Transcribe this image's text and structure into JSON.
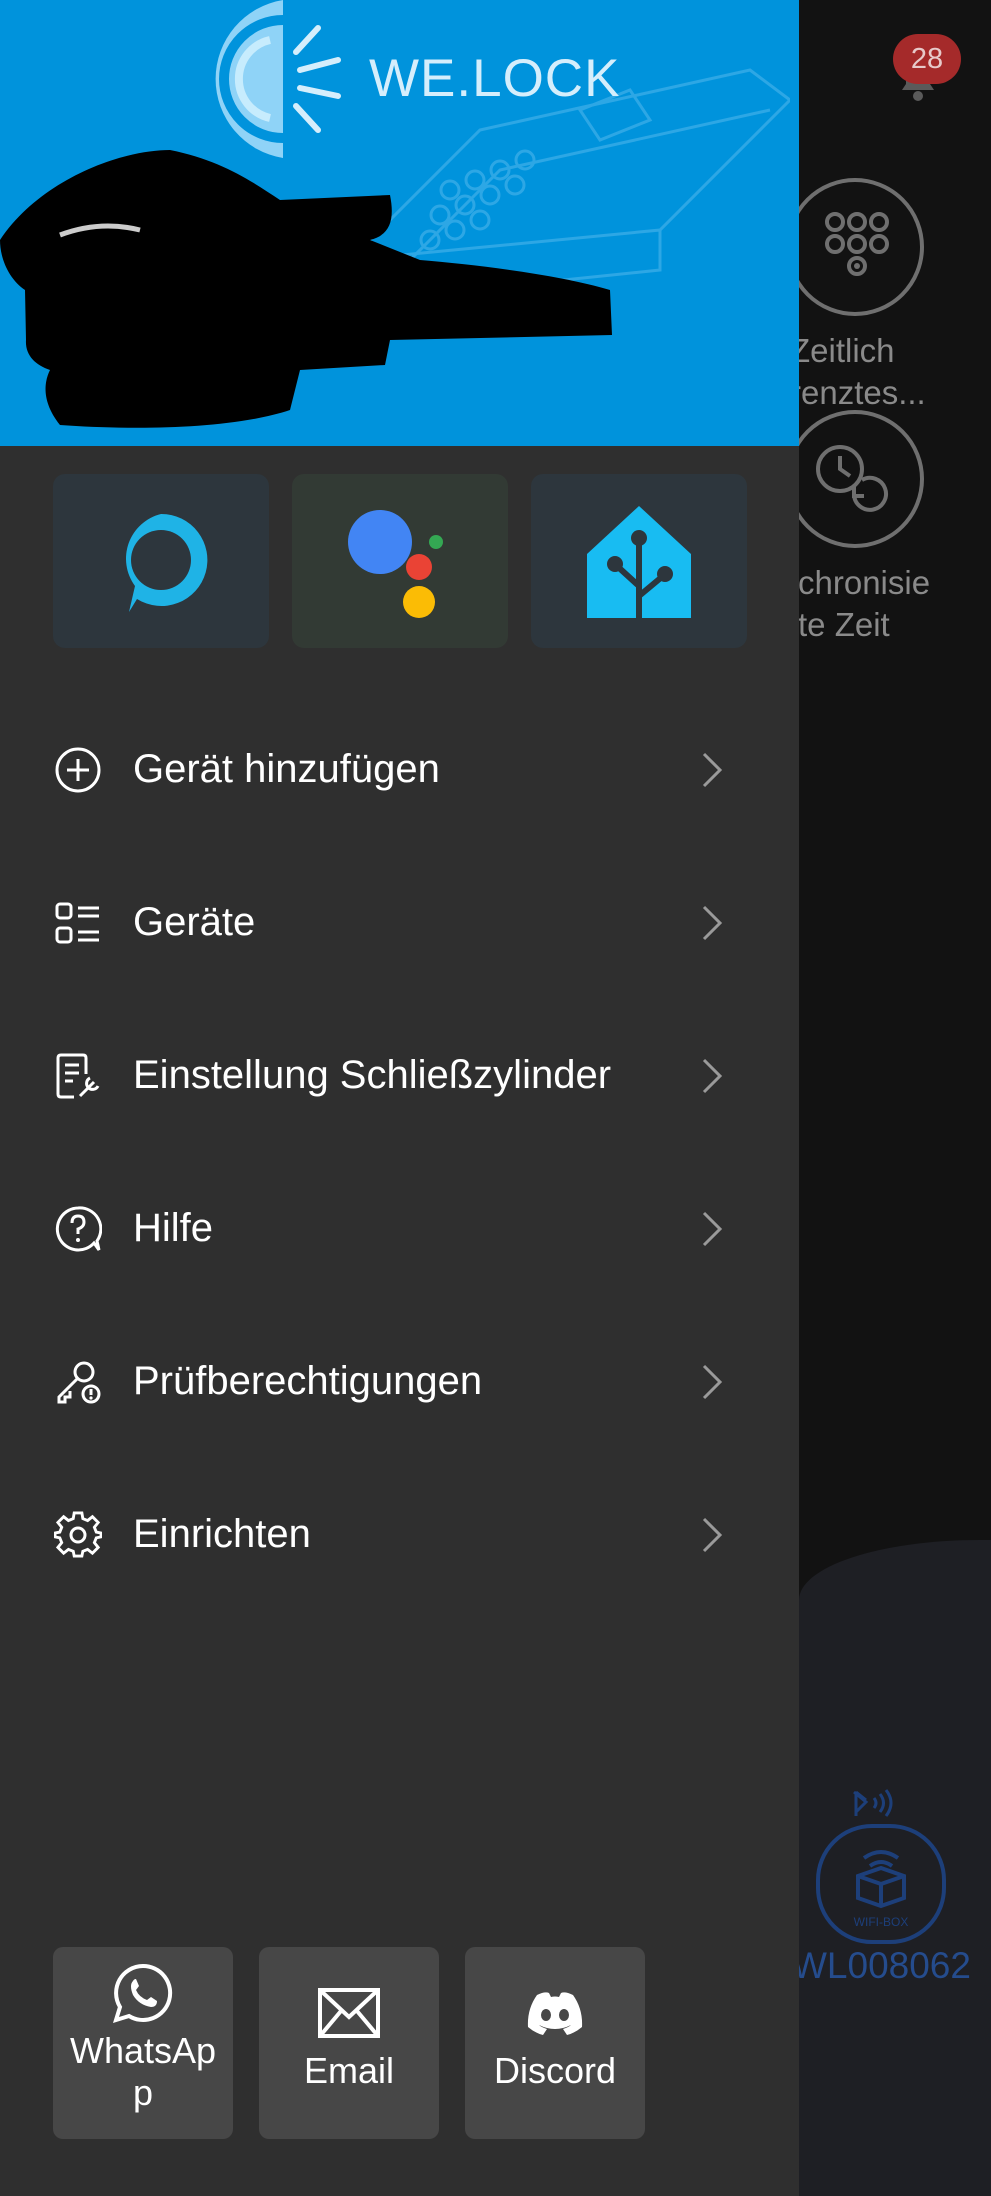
{
  "app": {
    "brand_name": "WE.LOCK"
  },
  "background": {
    "notification_count": "28",
    "actions": [
      {
        "label_line1": "Zeitlich",
        "label_line2": "renztes..."
      },
      {
        "label_line1": "chronisie",
        "label_line2": "te Zeit"
      }
    ],
    "device_id": "WL008062",
    "device_badge": "WIFI-BOX"
  },
  "assistants": [
    {
      "name": "Amazon Alexa",
      "icon": "alexa-icon"
    },
    {
      "name": "Google Assistant",
      "icon": "google-assistant-icon"
    },
    {
      "name": "Home Assistant",
      "icon": "home-assistant-icon"
    }
  ],
  "menu": [
    {
      "label": "Gerät hinzufügen",
      "icon": "add-circle-icon"
    },
    {
      "label": "Geräte",
      "icon": "device-list-icon"
    },
    {
      "label": "Einstellung Schließzylinder",
      "icon": "cylinder-settings-icon"
    },
    {
      "label": "Hilfe",
      "icon": "help-icon"
    },
    {
      "label": "Prüfberechtigungen",
      "icon": "key-permission-icon"
    },
    {
      "label": "Einrichten",
      "icon": "gear-icon"
    }
  ],
  "contacts": [
    {
      "label_line1": "WhatsAp",
      "label_line2": "p",
      "icon": "whatsapp-icon"
    },
    {
      "label": "Email",
      "icon": "email-icon"
    },
    {
      "label": "Discord",
      "icon": "discord-icon"
    }
  ],
  "colors": {
    "header_blue": "#0093dc",
    "drawer_bg": "#2f2f2f",
    "tile_bg": "#474747",
    "alexa": "#1fb3e6",
    "home_assistant": "#18bcf2",
    "badge_red": "#a52a2a"
  }
}
